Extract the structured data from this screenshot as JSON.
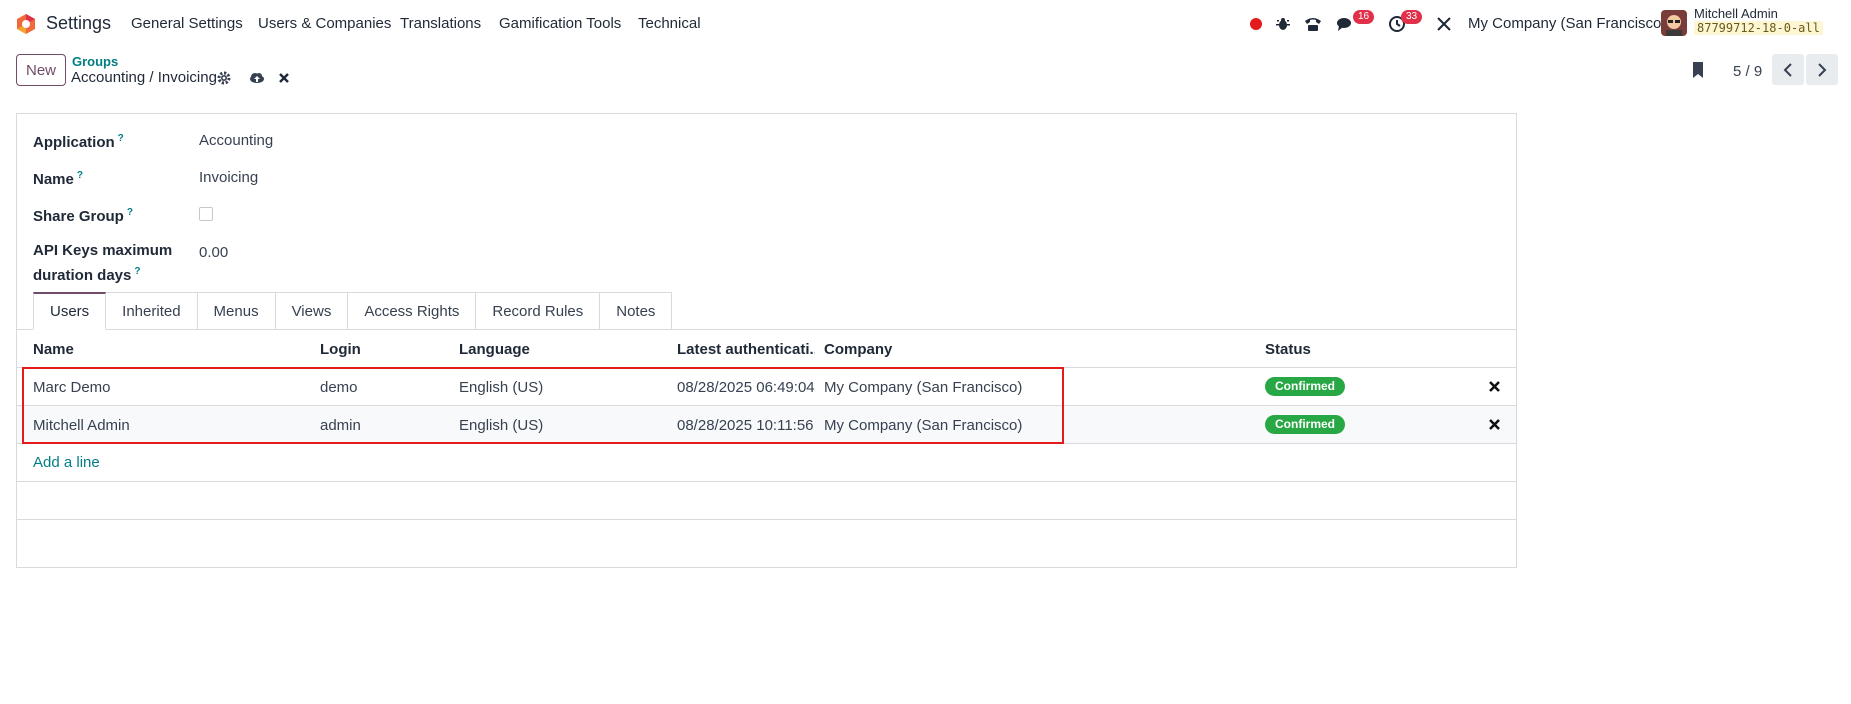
{
  "navbar": {
    "app_name": "Settings",
    "menu": [
      "General Settings",
      "Users & Companies",
      "Translations",
      "Gamification Tools",
      "Technical"
    ],
    "icons": [
      "record-dot-icon",
      "bug-icon",
      "phone-icon",
      "chat-icon",
      "clock-icon",
      "tools-icon"
    ],
    "chat_badge": "16",
    "activity_badge": "33",
    "company": "My Company (San Francisco)",
    "user_name": "Mitchell Admin",
    "db_name": "87799712-18-0-all"
  },
  "control_panel": {
    "new_label": "New",
    "breadcrumb": "Groups",
    "record_title": "Accounting / Invoicing",
    "pager_value": "5 / 9"
  },
  "form": {
    "application_label": "Application",
    "application_value": "Accounting",
    "name_label": "Name",
    "name_value": "Invoicing",
    "share_label": "Share Group",
    "api_label_line1": "API Keys maximum",
    "api_label_line2": "duration days",
    "api_value": "0.00",
    "help_mark": "?"
  },
  "tabs": [
    "Users",
    "Inherited",
    "Menus",
    "Views",
    "Access Rights",
    "Record Rules",
    "Notes"
  ],
  "table": {
    "headers": [
      "Name",
      "Login",
      "Language",
      "Latest authenticati...",
      "Company",
      "Status"
    ],
    "rows": [
      {
        "name": "Marc Demo",
        "login": "demo",
        "language": "English (US)",
        "latest": "08/28/2025 06:49:04",
        "company": "My Company (San Francisco)",
        "status": "Confirmed"
      },
      {
        "name": "Mitchell Admin",
        "login": "admin",
        "language": "English (US)",
        "latest": "08/28/2025 10:11:56",
        "company": "My Company (San Francisco)",
        "status": "Confirmed"
      }
    ],
    "add_line": "Add a line"
  },
  "colors": {
    "brand": "#714b67",
    "link": "#017e84",
    "status_confirmed": "#28a745",
    "badge": "#e0304a",
    "highlight": "#e41b1b"
  }
}
